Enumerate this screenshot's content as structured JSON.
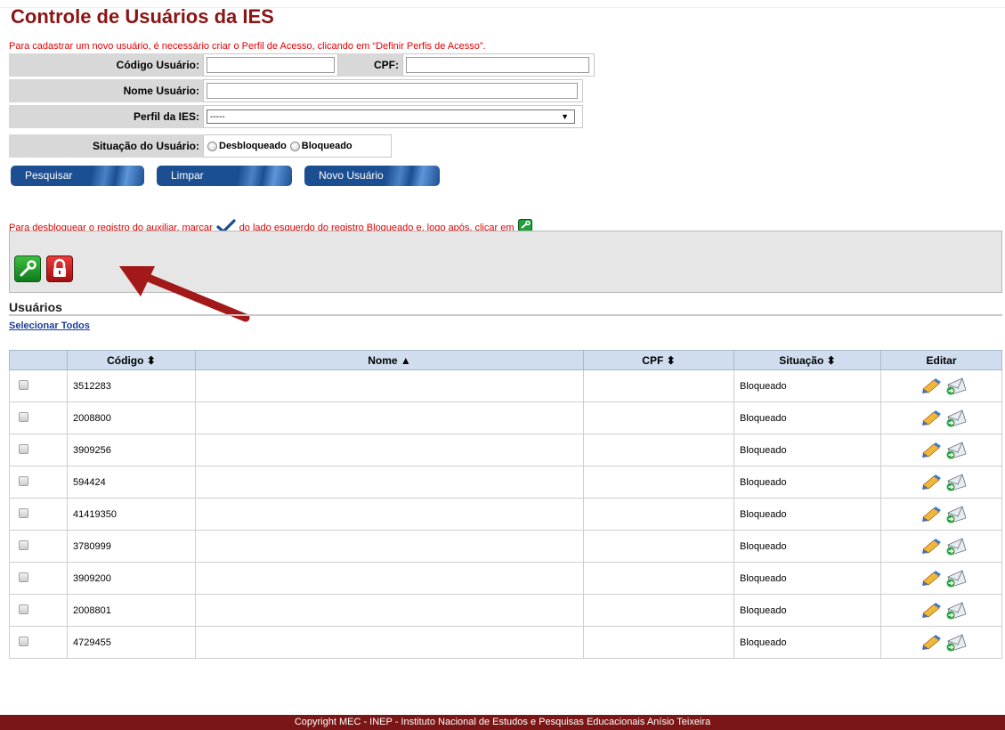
{
  "page": {
    "title": "Controle de Usuários da IES",
    "notice_register": "Para cadastrar um novo usuário, é necessário criar o Perfil de Acesso, clicando em “Definir Perfis de Acesso”.",
    "notice_unlock_before": "Para desbloquear o registro do auxiliar, marcar",
    "notice_unlock_after": "do lado esquerdo do registro Bloqueado e, logo após, clicar em"
  },
  "form": {
    "codigo_label": "Código Usuário:",
    "codigo_value": "",
    "cpf_label": "CPF:",
    "cpf_value": "",
    "nome_label": "Nome Usuário:",
    "nome_value": "",
    "perfil_label": "Perfil da IES:",
    "perfil_selected": "-----",
    "situacao_label": "Situação do Usuário:",
    "situacao_options": [
      "Desbloqueado",
      "Bloqueado"
    ]
  },
  "buttons": {
    "pesquisar": "Pesquisar",
    "limpar": "Limpar",
    "novo_usuario": "Novo Usuário"
  },
  "users_section": {
    "title": "Usuários",
    "select_all": "Selecionar Todos"
  },
  "table": {
    "headers": [
      "",
      "Código ⬍",
      "Nome ▲",
      "CPF ⬍",
      "Situação ⬍",
      "Editar"
    ],
    "rows": [
      {
        "codigo": "3512283",
        "nome": "",
        "cpf": "",
        "situacao": "Bloqueado"
      },
      {
        "codigo": "2008800",
        "nome": "",
        "cpf": "",
        "situacao": "Bloqueado"
      },
      {
        "codigo": "3909256",
        "nome": "",
        "cpf": "",
        "situacao": "Bloqueado"
      },
      {
        "codigo": "594424",
        "nome": "",
        "cpf": "",
        "situacao": "Bloqueado"
      },
      {
        "codigo": "41419350",
        "nome": "",
        "cpf": "",
        "situacao": "Bloqueado"
      },
      {
        "codigo": "3780999",
        "nome": "",
        "cpf": "",
        "situacao": "Bloqueado"
      },
      {
        "codigo": "3909200",
        "nome": "",
        "cpf": "",
        "situacao": "Bloqueado"
      },
      {
        "codigo": "2008801",
        "nome": "",
        "cpf": "",
        "situacao": "Bloqueado"
      },
      {
        "codigo": "4729455",
        "nome": "",
        "cpf": "",
        "situacao": "Bloqueado"
      }
    ]
  },
  "icons": {
    "checkmark": "checkmark-icon",
    "unlock": "unlock-key-icon",
    "lock": "lock-icon",
    "edit": "pencil-edit-icon",
    "send": "envelope-send-icon",
    "arrow": "arrow-annotation-icon"
  },
  "colors": {
    "title": "#8b1414",
    "notice": "#e00000",
    "button": "#1c4f92",
    "footer": "#7b1616",
    "header_row": "#cfddee"
  },
  "footer": {
    "text": "Copyright MEC - INEP - Instituto Nacional de Estudos e Pesquisas Educacionais Anísio Teixeira"
  }
}
